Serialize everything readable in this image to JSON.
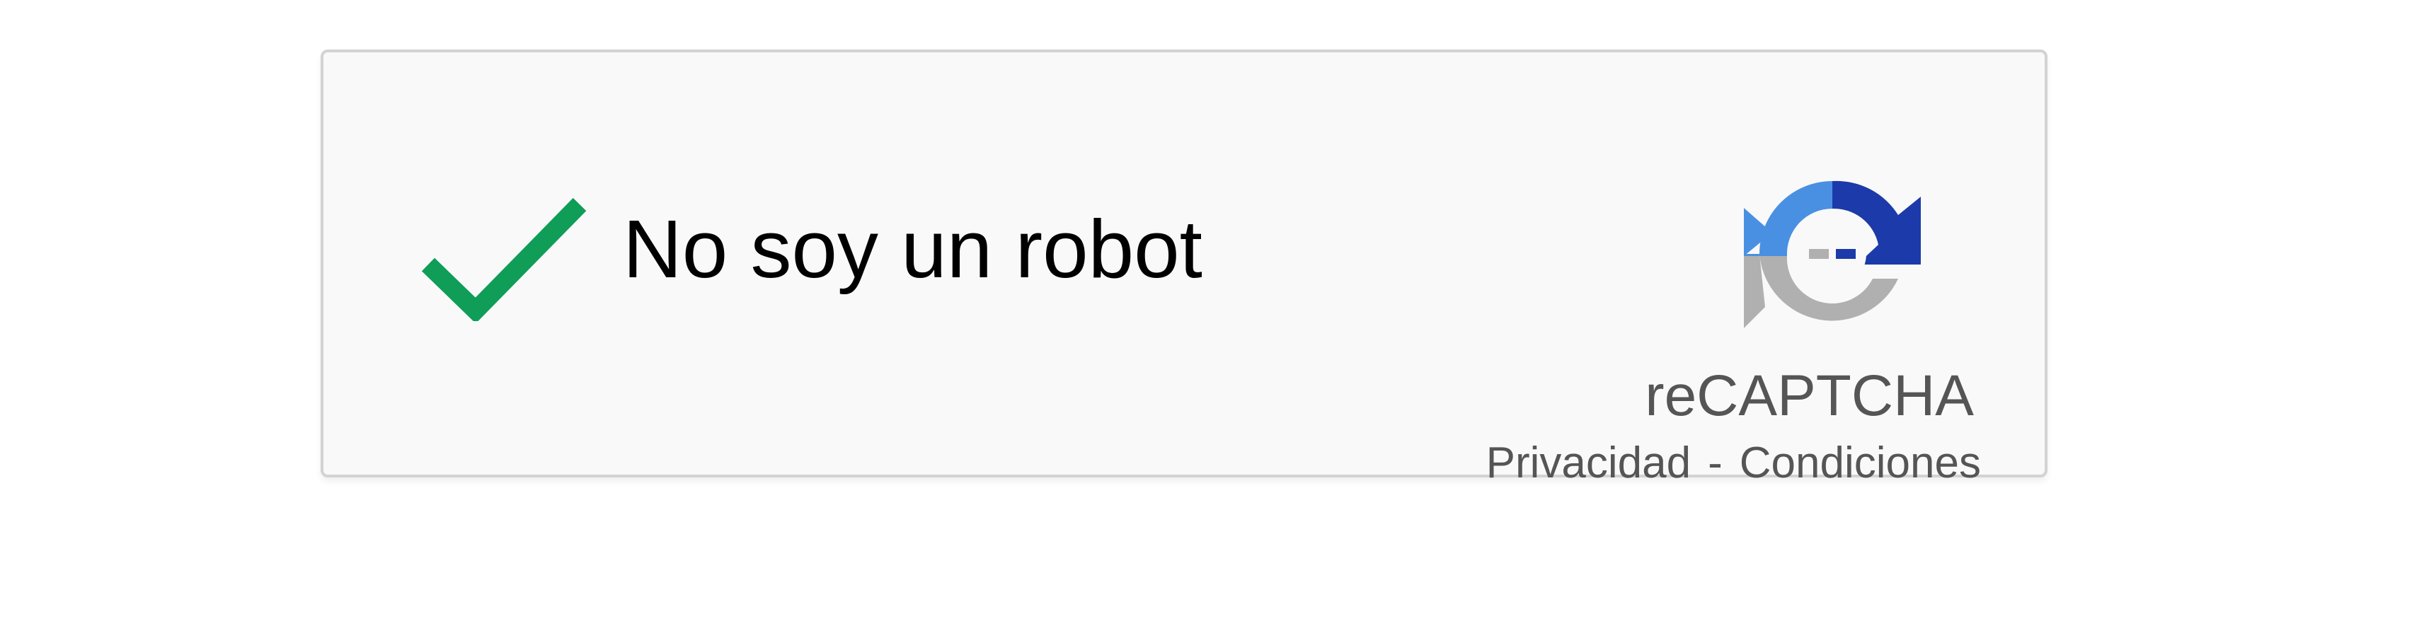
{
  "widget": {
    "label": "No soy un robot",
    "checked": true,
    "brand": "reCAPTCHA",
    "privacy_link": "Privacidad",
    "separator": "-",
    "terms_link": "Condiciones"
  },
  "icons": {
    "check": "checkmark-icon",
    "logo": "recaptcha-logo-icon"
  },
  "colors": {
    "check_green": "#0f9d58",
    "logo_light_blue": "#4a90e2",
    "logo_dark_blue": "#1c3aa9",
    "logo_gray": "#b0b0b0",
    "text_gray": "#555555"
  }
}
